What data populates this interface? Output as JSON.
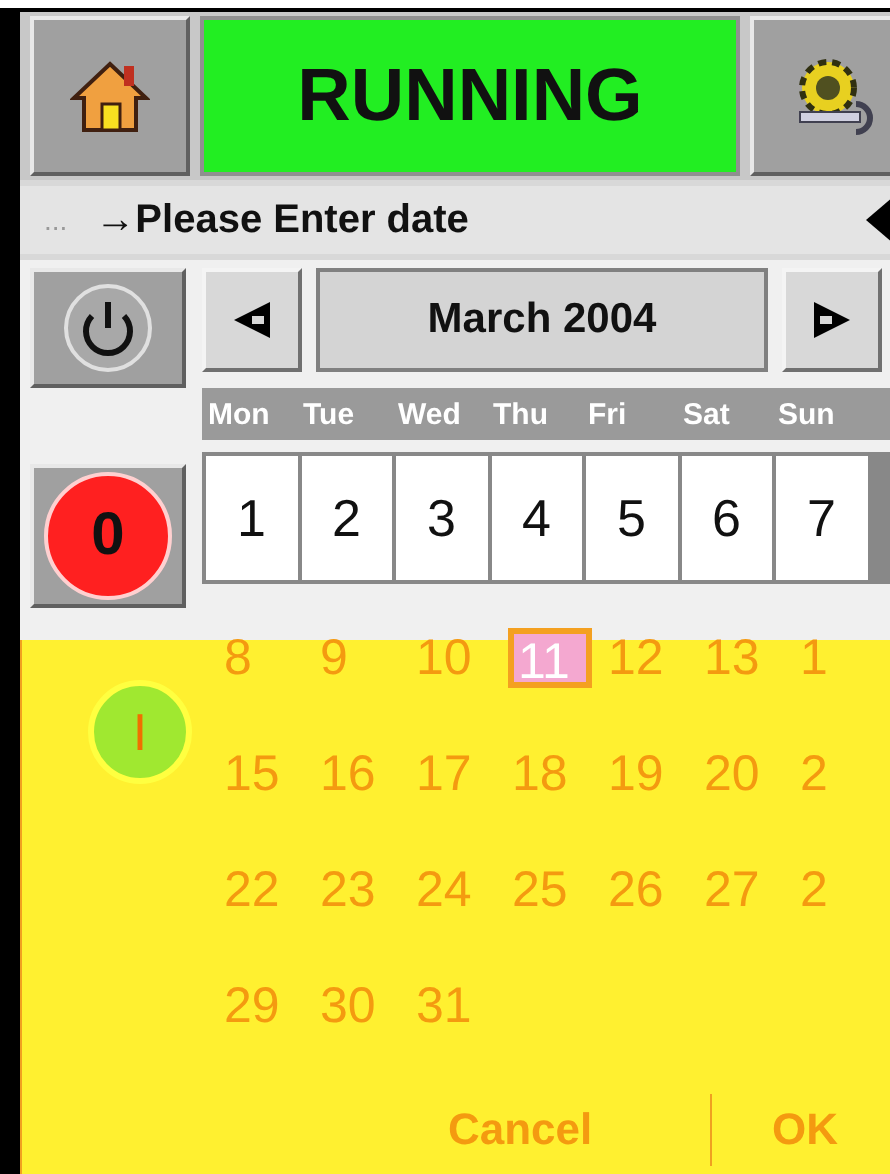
{
  "header": {
    "status": "RUNNING"
  },
  "prompt": {
    "prefix": "...",
    "text": "→Please Enter date"
  },
  "side_buttons": [
    {
      "kind": "power"
    },
    {
      "kind": "stop",
      "label": "0"
    }
  ],
  "calendar": {
    "month": "March 2004",
    "weekdays": [
      "Mon",
      "Tue",
      "Wed",
      "Thu",
      "Fri",
      "Sat",
      "Sun"
    ],
    "weeks": [
      [
        {
          "label": "1",
          "selected": false
        },
        {
          "label": "2",
          "selected": false
        },
        {
          "label": "3",
          "selected": false
        },
        {
          "label": "4",
          "selected": false
        },
        {
          "label": "5",
          "selected": false
        },
        {
          "label": "6",
          "selected": false
        },
        {
          "label": "7",
          "selected": false
        }
      ]
    ]
  },
  "overlay": {
    "start_button": {
      "label": "I"
    },
    "weeks": [
      [
        {
          "label": "8",
          "selected": false
        },
        {
          "label": "9",
          "selected": false
        },
        {
          "label": "10",
          "selected": false
        },
        {
          "label": "11",
          "selected": true
        },
        {
          "label": "12",
          "selected": false
        },
        {
          "label": "13",
          "selected": false
        },
        {
          "label": "1",
          "selected": false
        }
      ],
      [
        {
          "label": "15",
          "selected": false
        },
        {
          "label": "16",
          "selected": false
        },
        {
          "label": "17",
          "selected": false
        },
        {
          "label": "18",
          "selected": false
        },
        {
          "label": "19",
          "selected": false
        },
        {
          "label": "20",
          "selected": false
        },
        {
          "label": "2",
          "selected": false
        }
      ],
      [
        {
          "label": "22",
          "selected": false
        },
        {
          "label": "23",
          "selected": false
        },
        {
          "label": "24",
          "selected": false
        },
        {
          "label": "25",
          "selected": false
        },
        {
          "label": "26",
          "selected": false
        },
        {
          "label": "27",
          "selected": false
        },
        {
          "label": "2",
          "selected": false
        }
      ],
      [
        {
          "label": "29",
          "selected": false
        },
        {
          "label": "30",
          "selected": false
        },
        {
          "label": "31",
          "selected": false
        }
      ]
    ],
    "buttons": [
      "Cancel",
      "OK"
    ]
  }
}
